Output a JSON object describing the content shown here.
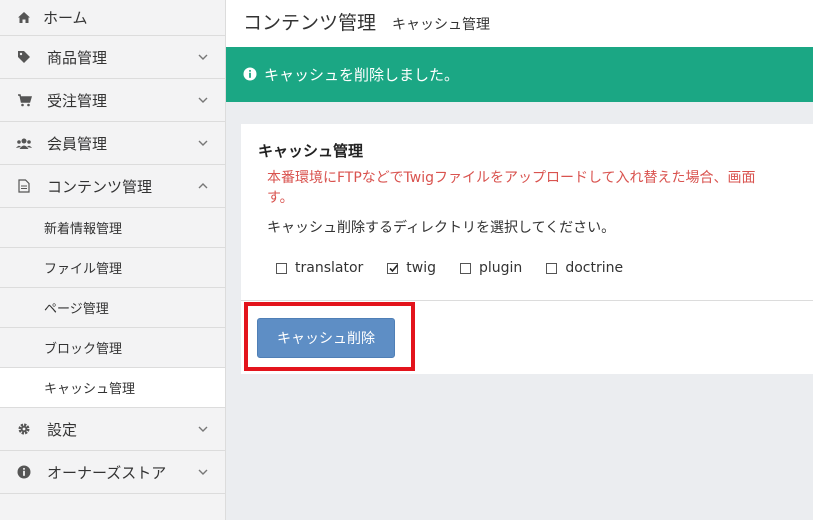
{
  "sidebar": {
    "items": [
      {
        "label": "ホーム",
        "icon": "home-icon"
      },
      {
        "label": "商品管理",
        "icon": "tag-icon"
      },
      {
        "label": "受注管理",
        "icon": "cart-icon"
      },
      {
        "label": "会員管理",
        "icon": "users-icon"
      },
      {
        "label": "コンテンツ管理",
        "icon": "file-icon"
      },
      {
        "label": "設定",
        "icon": "gear-icon"
      },
      {
        "label": "オーナーズストア",
        "icon": "info-icon"
      }
    ],
    "subitems": [
      {
        "label": "新着情報管理"
      },
      {
        "label": "ファイル管理"
      },
      {
        "label": "ページ管理"
      },
      {
        "label": "ブロック管理"
      },
      {
        "label": "キャッシュ管理",
        "active": true
      }
    ]
  },
  "header": {
    "title": "コンテンツ管理",
    "subtitle": "キャッシュ管理"
  },
  "alert": {
    "message": "キャッシュを削除しました。",
    "color": "#1ba784"
  },
  "card": {
    "title": "キャッシュ管理",
    "warning_line1": "本番環境にFTPなどでTwigファイルをアップロードして入れ替えた場合、画面",
    "warning_line2": "す。",
    "instruction": "キャッシュ削除するディレクトリを選択してください。",
    "checkboxes": [
      {
        "label": "translator",
        "checked": false
      },
      {
        "label": "twig",
        "checked": true
      },
      {
        "label": "plugin",
        "checked": false
      },
      {
        "label": "doctrine",
        "checked": false
      }
    ],
    "button_label": "キャッシュ削除"
  },
  "colors": {
    "accent_button": "#5e8ec5",
    "warning_text": "#d9534f",
    "highlight": "#e3141c"
  }
}
